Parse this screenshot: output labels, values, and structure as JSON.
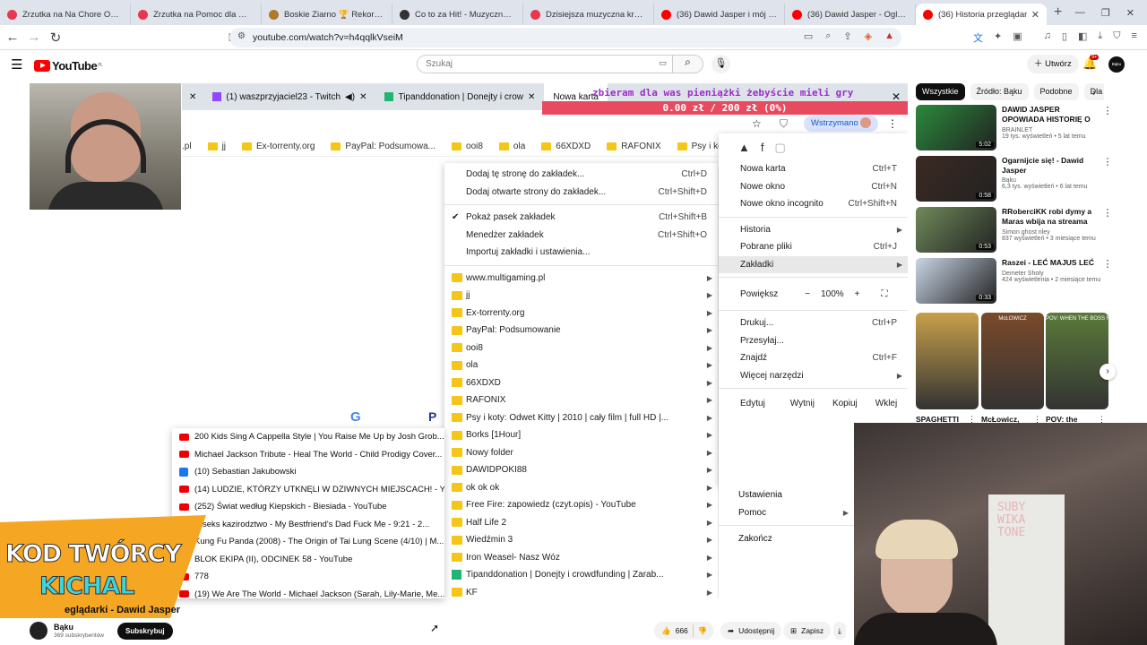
{
  "browser": {
    "tabs": [
      {
        "title": "Zrzutka na Na Chore Osoby - Z",
        "color": "#e8384f"
      },
      {
        "title": "Zrzutka na Pomoc dla Małego",
        "color": "#e8384f"
      },
      {
        "title": "Boskie Ziarno 🏆 Rekordy stre",
        "color": "#b07a2a"
      },
      {
        "title": "Co to za Hit! - Muzyczny Quiz",
        "color": "#333"
      },
      {
        "title": "Dzisiejsza muzyczna krzyżówk",
        "color": "#e8384f"
      },
      {
        "title": "(36) Dawid Jasper i mój zajebi",
        "color": "#f00"
      },
      {
        "title": "(36) Dawid Jasper - Oglądanie",
        "color": "#f00"
      },
      {
        "title": "(36) Historia przeglądar",
        "color": "#f00",
        "active": true
      }
    ],
    "url": "youtube.com/watch?v=h4qqlkVseiM"
  },
  "youtube": {
    "logo_text": "YouTube",
    "logo_region": "PL",
    "search_placeholder": "Szukaj",
    "create_label": "Utwórz",
    "notif_badge": "9+",
    "avatar_text": "Bąku"
  },
  "video": {
    "inner_tabs": [
      "(1) waszprzyjaciel23 - Twitch",
      "Tipanddonation | Donejty i crow",
      "Nowa karta"
    ],
    "donation_text": "zbieram dla was pieniążki żebyście mieli gry",
    "donation_progress": "0.00 zł / 200 zł (0%)",
    "status_label": "Wstrzymano",
    "bookmarks_bar": [
      ".pl",
      "jj",
      "Ex-torrenty.org",
      "PayPal: Podsumowa...",
      "ooi8",
      "ola",
      "66XDXD",
      "RAFONIX",
      "Psy i koty: Odwet Ki..."
    ],
    "bookmarks_menu_top": [
      {
        "label": "Dodaj tę stronę do zakładek...",
        "shortcut": "Ctrl+D"
      },
      {
        "label": "Dodaj otwarte strony do zakładek...",
        "shortcut": "Ctrl+Shift+D"
      }
    ],
    "bookmarks_menu_mid": [
      {
        "label": "Pokaż pasek zakładek",
        "shortcut": "Ctrl+Shift+B",
        "checked": true
      },
      {
        "label": "Menedżer zakładek",
        "shortcut": "Ctrl+Shift+O"
      },
      {
        "label": "Importuj zakładki i ustawienia..."
      }
    ],
    "bookmark_folders": [
      "www.multigaming.pl",
      "jj",
      "Ex-torrenty.org",
      "PayPal: Podsumowanie",
      "ooi8",
      "ola",
      "66XDXD",
      "RAFONIX",
      "Psy i koty: Odwet Kitty | 2010 | cały film | full HD |...",
      "Borks [1Hour]",
      "Nowy folder",
      "DAWIDPOKI88",
      "ok ok ok",
      "Free Fire: zapowiedz (czyt.opis) - YouTube",
      "Half Life 2",
      "Wiedźmin 3",
      "Iron Weasel- Nasz Wóz",
      "Tipanddonation | Donejty i crowdfunding | Zarab...",
      "KF"
    ],
    "chrome_menu": [
      {
        "label": "Nowa karta",
        "shortcut": "Ctrl+T"
      },
      {
        "label": "Nowe okno",
        "shortcut": "Ctrl+N"
      },
      {
        "label": "Nowe okno incognito",
        "shortcut": "Ctrl+Shift+N"
      },
      {
        "label": "Historia",
        "arrow": true
      },
      {
        "label": "Pobrane pliki",
        "shortcut": "Ctrl+J"
      },
      {
        "label": "Zakładki",
        "arrow": true
      },
      {
        "label": "Powiększ"
      },
      {
        "label": "Drukuj...",
        "shortcut": "Ctrl+P"
      },
      {
        "label": "Przesyłaj..."
      },
      {
        "label": "Znajdź",
        "shortcut": "Ctrl+F"
      },
      {
        "label": "Więcej narzędzi",
        "arrow": true
      },
      {
        "label": "Edytuj"
      },
      {
        "label": "Ustawienia"
      },
      {
        "label": "Pomoc",
        "arrow": true
      },
      {
        "label": "Zakończ"
      }
    ],
    "zoom_minus": "−",
    "zoom_value": "100%",
    "zoom_plus": "+",
    "edit_cut": "Wytnij",
    "edit_copy": "Kopiuj",
    "edit_paste": "Wklej",
    "history_popup": [
      {
        "icon": "yt",
        "label": "200 Kids Sing A Cappella Style | You Raise Me Up by Josh Grob..."
      },
      {
        "icon": "yt",
        "label": "Michael Jackson Tribute - Heal The World - Child Prodigy Cover..."
      },
      {
        "icon": "fb",
        "label": "(10) Sebastian Jakubowski"
      },
      {
        "icon": "yt",
        "label": "(14) LUDZIE, KTÓRZY UTKNĘLI W DZIWNYCH MIEJSCACH! - Yo..."
      },
      {
        "icon": "yt",
        "label": "(252) Świat według Kiepskich - Biesiada - YouTube"
      },
      {
        "icon": "yt",
        "label": "X seks kazirodztwo - My Bestfriend's Dad Fuck Me - 9:21 - 2..."
      },
      {
        "icon": "yt",
        "label": "Kung Fu Panda (2008) - The Origin of Tai Lung Scene (4/10) | M..."
      },
      {
        "icon": "yt",
        "label": "BLOK EKIPA (II), ODCINEK 58 - YouTube"
      },
      {
        "icon": "yt",
        "label": "778"
      },
      {
        "icon": "yt",
        "label": "(19) We Are The World - Michael Jackson (Sarah, Lily-Marie, Me..."
      }
    ],
    "creator_code_line1": "KOD TWÓRCY",
    "creator_code_line2": "KICHAL",
    "video_title_partial": "eglądarki - Dawid Jasper"
  },
  "sidebar": {
    "chips": [
      "Wszystkie",
      "Źródło: Bąku",
      "Podobne",
      "Dla Cie"
    ],
    "recommendations": [
      {
        "title": "DAWID JASPER OPOWIADA HISTORIĘ O SWOIM SYNU",
        "channel": "BRAINLET",
        "views": "19 tys. wyświetleń • 5 lat temu",
        "duration": "5:02",
        "color": "#2a8a3c"
      },
      {
        "title": "Ogarnijcie się! - Dawid Jasper",
        "channel": "Bąku",
        "views": "6,3 tys. wyświetleń • 6 lat temu",
        "duration": "0:58",
        "color": "#3b2a22"
      },
      {
        "title": "RRoberciKK robi dymy a Maras wbija na streama [REUPLOAD]",
        "channel": "Simon ghost riley",
        "views": "837 wyświetleń • 3 miesiące temu",
        "duration": "0:53",
        "color": "#6f8a5a"
      },
      {
        "title": "Raszei - LEĆ MAJUS LEĆ",
        "channel": "Demeter Shoty",
        "views": "424 wyświetlenia • 2 miesiące temu",
        "duration": "0:33",
        "color": "#c9d6e6"
      }
    ],
    "shorts": [
      {
        "title": "SPAGHETTI",
        "color": "#c7a04a"
      },
      {
        "title": "McŁowicz,",
        "color": "#7a4a2a"
      },
      {
        "title": "POV: the",
        "color": "#5a7a3a"
      }
    ],
    "shorts_overlay": [
      "McŁOWICZ",
      "POV: WHEN THE BOSS FIGHT"
    ]
  },
  "player_bar": {
    "channel": "Bąku",
    "subscribers": "369 subskrybentów",
    "subscribe_label": "Subskrybuj",
    "likes": "666",
    "share_label": "Udostępnij",
    "save_label": "Zapisz"
  },
  "colors": {
    "youtube_red": "#ff0000",
    "donation_bar": "#e84a5f",
    "donation_text": "#9b2ec9",
    "creator_code_orange": "#f5a623"
  }
}
